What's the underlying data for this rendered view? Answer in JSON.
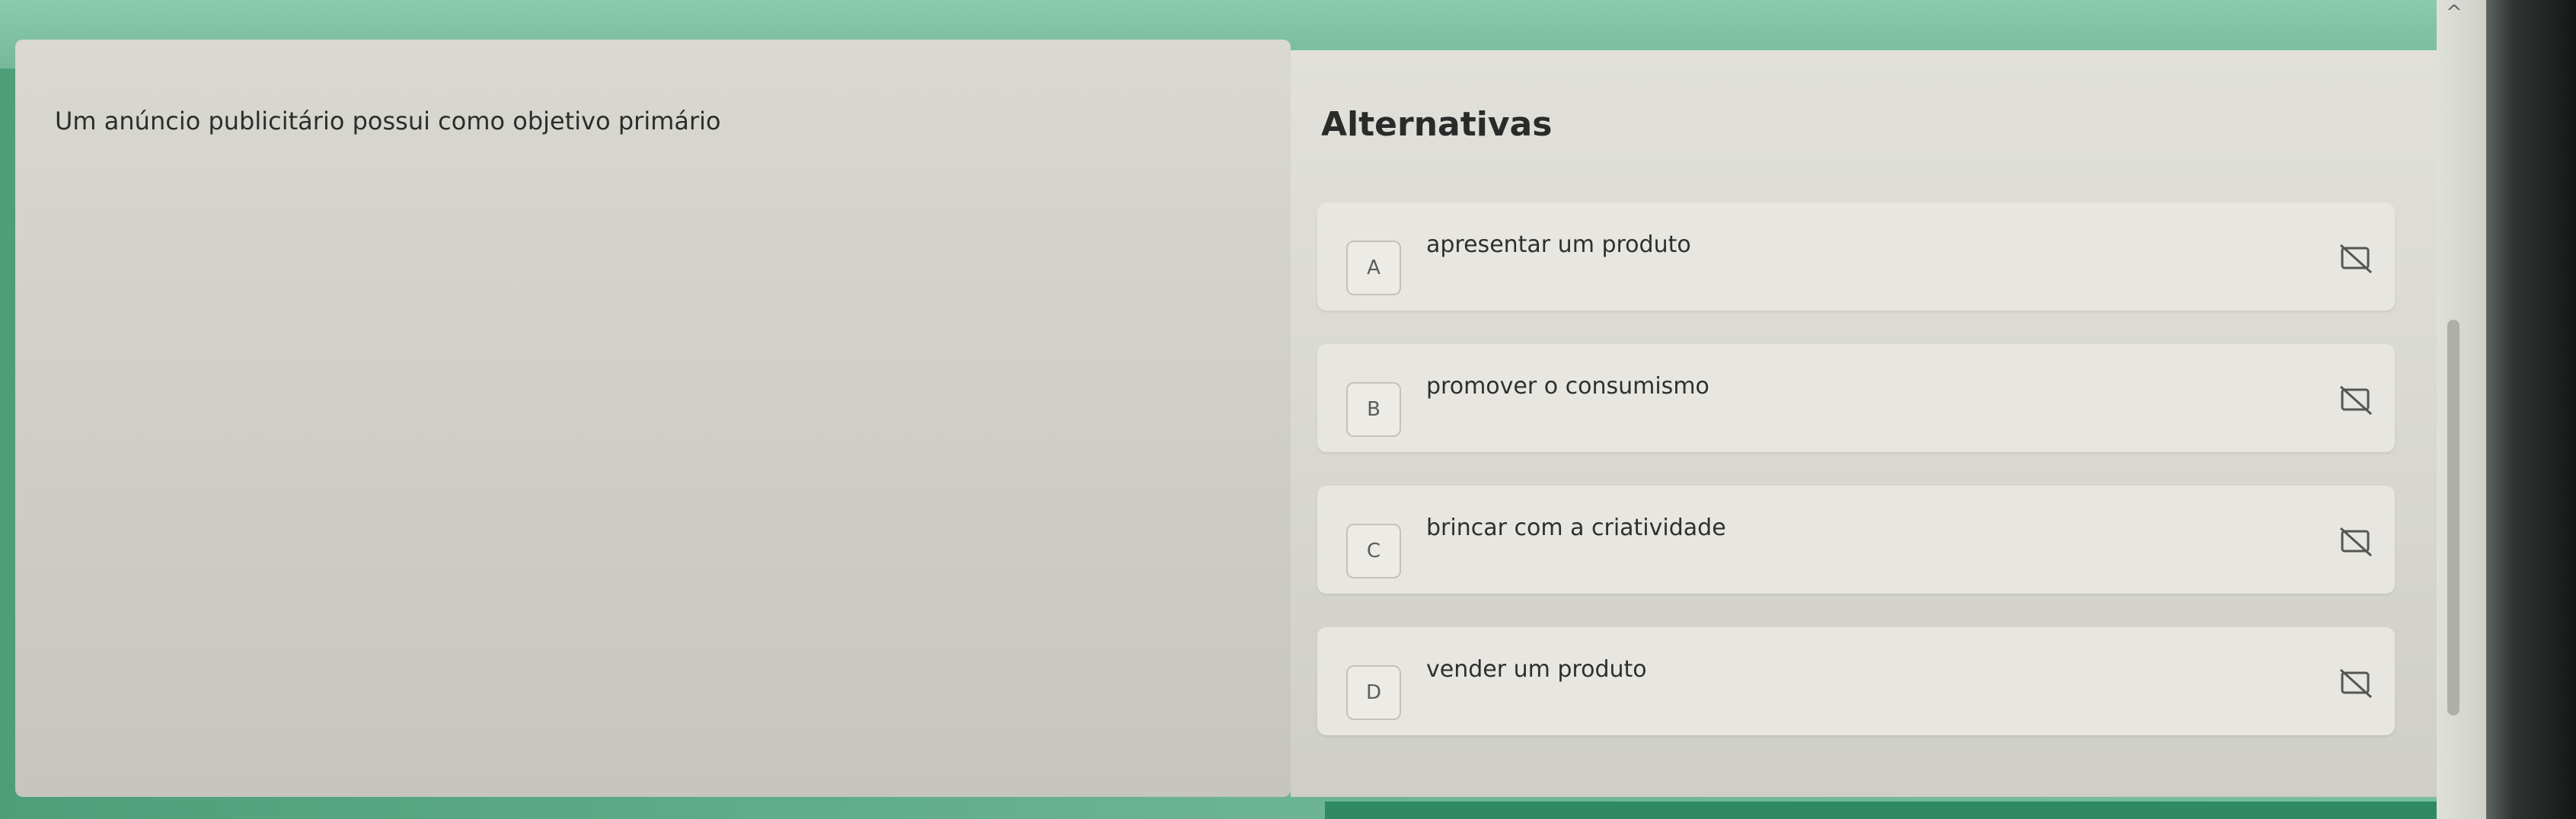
{
  "question": {
    "text": "Um anúncio publicitário possui como objetivo primário"
  },
  "answers": {
    "title": "Alternativas",
    "options": [
      {
        "letter": "A",
        "text": "apresentar um produto",
        "icon": "eliminate-option-icon"
      },
      {
        "letter": "B",
        "text": "promover o consumismo",
        "icon": "eliminate-option-icon"
      },
      {
        "letter": "C",
        "text": "brincar com a criatividade",
        "icon": "eliminate-option-icon"
      },
      {
        "letter": "D",
        "text": "vender um produto",
        "icon": "eliminate-option-icon"
      }
    ]
  },
  "scrollbar": {
    "up_arrow_icon": "chevron-up-icon"
  },
  "colors": {
    "accent_green": "#2f8a63",
    "panel_bg": "#e7e6e0",
    "text": "#2f2f2f"
  }
}
